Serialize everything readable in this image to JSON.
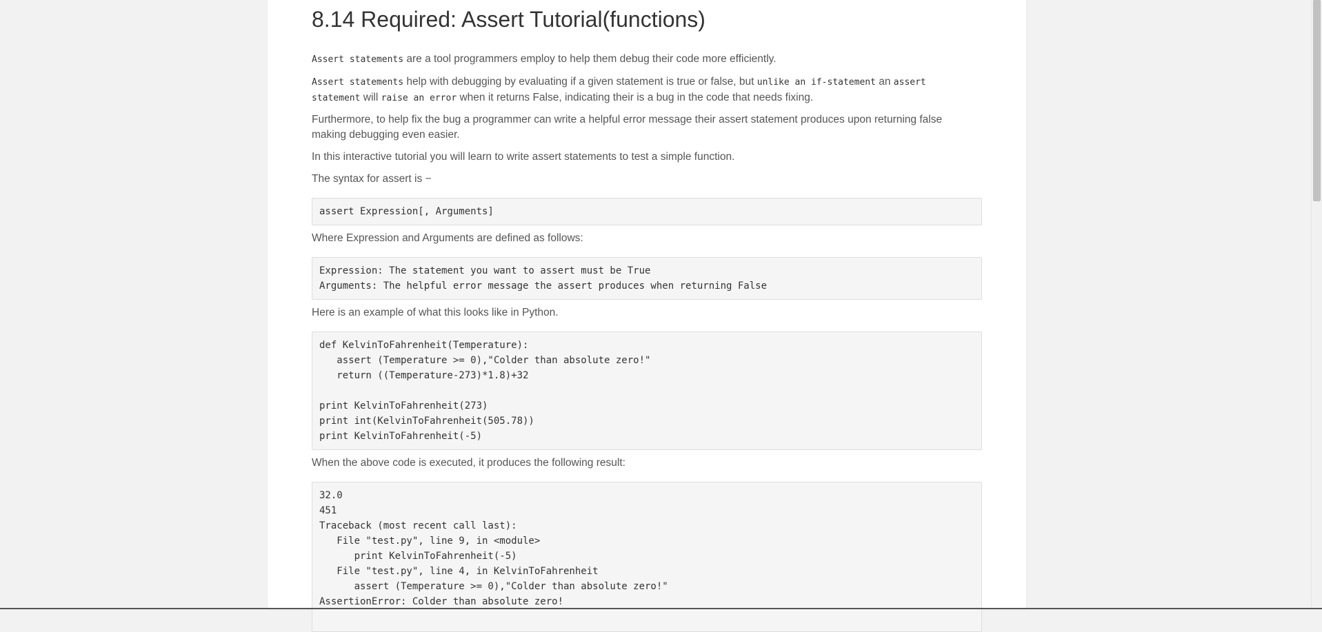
{
  "title": "8.14 Required: Assert Tutorial(functions)",
  "para1": {
    "code1": "Assert statements",
    "text1": " are a tool programmers employ to help them debug their code more efficiently."
  },
  "para2": {
    "code1": "Assert statements",
    "text1": " help with debugging by evaluating if a given statement is true or false, but ",
    "code2": "unlike an if-statement",
    "text2": " an ",
    "code3": "assert statement",
    "text3": " will ",
    "code4": "raise an error",
    "text4": " when it returns False, indicating their is a bug in the code that needs fixing."
  },
  "para3": "Furthermore, to help fix the bug a programmer can write a helpful error message their assert statement produces upon returning false making debugging even easier.",
  "para4": "In this interactive tutorial you will learn to write assert statements to test a simple function.",
  "para5": "The syntax for assert is −",
  "code_syntax": "assert Expression[, Arguments]",
  "para6": "Where Expression and Arguments are defined as follows:",
  "code_definitions": "Expression: The statement you want to assert must be True\nArguments: The helpful error message the assert produces when returning False",
  "para7": "Here is an example of what this looks like in Python.",
  "code_example": "def KelvinToFahrenheit(Temperature):\n   assert (Temperature >= 0),\"Colder than absolute zero!\"\n   return ((Temperature-273)*1.8)+32\n\nprint KelvinToFahrenheit(273)\nprint int(KelvinToFahrenheit(505.78))\nprint KelvinToFahrenheit(-5)",
  "para8": "When the above code is executed, it produces the following result:",
  "code_result": "32.0\n451\nTraceback (most recent call last):\n   File \"test.py\", line 9, in <module>\n      print KelvinToFahrenheit(-5)\n   File \"test.py\", line 4, in KelvinToFahrenheit\n      assert (Temperature >= 0),\"Colder than absolute zero!\"\nAssertionError: Colder than absolute zero!"
}
